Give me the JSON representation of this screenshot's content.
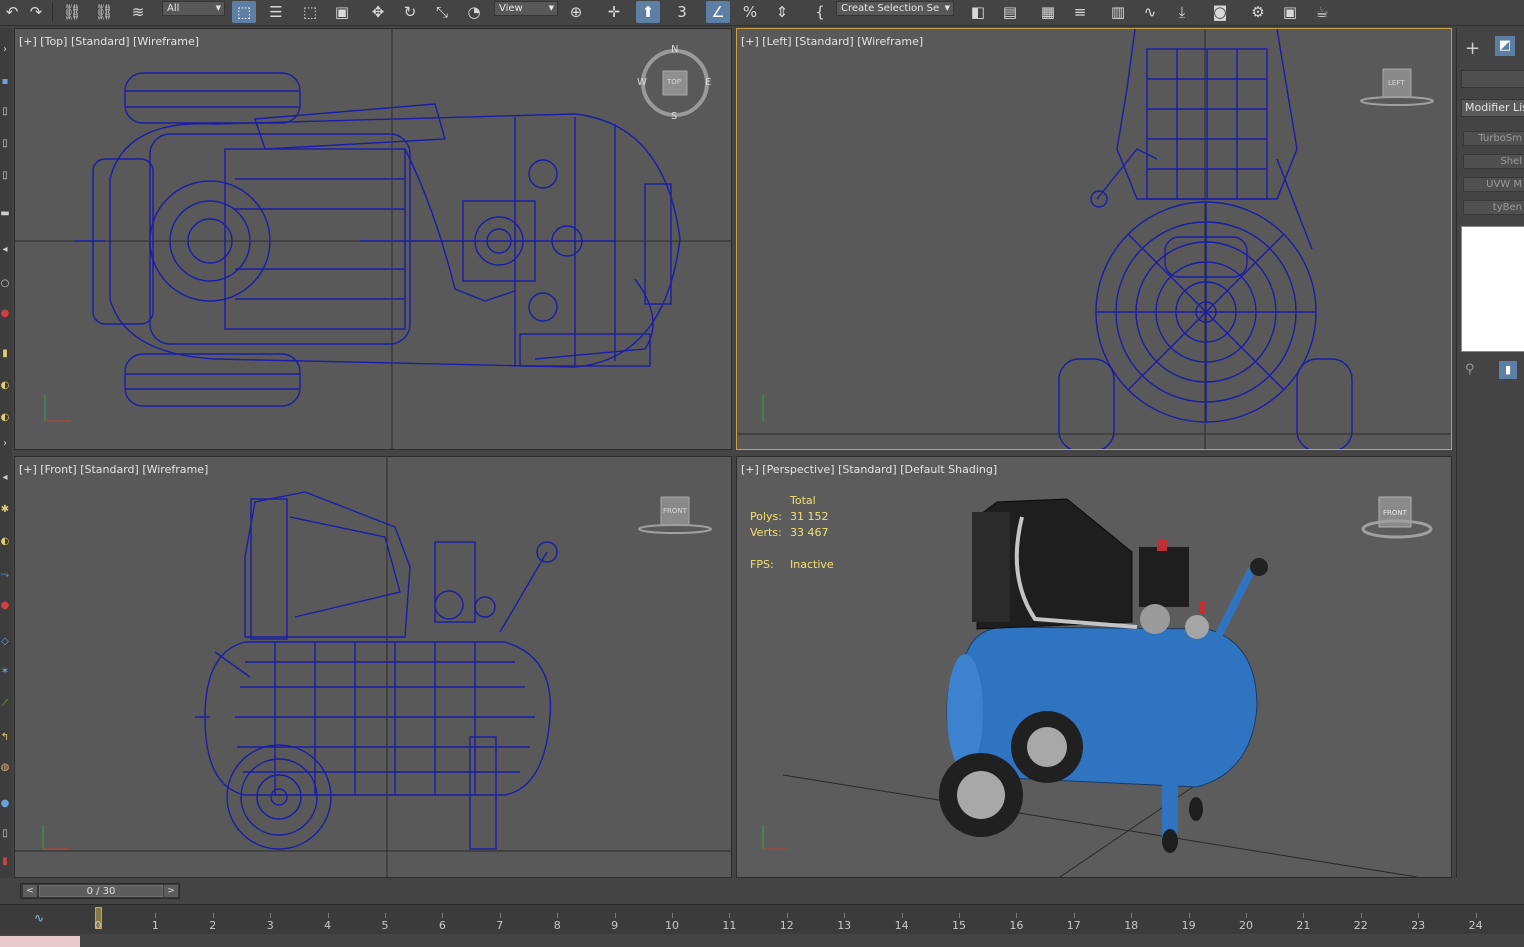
{
  "toolbar": {
    "selection_filter": "All",
    "coord_system": "View",
    "named_selection": "Create Selection Se"
  },
  "viewports": {
    "top": {
      "label": "[+] [Top] [Standard] [Wireframe]",
      "cube": "TOP",
      "compass": {
        "n": "N",
        "s": "S",
        "e": "E",
        "w": "W"
      }
    },
    "left": {
      "label": "[+] [Left] [Standard] [Wireframe]",
      "cube": "LEFT"
    },
    "front": {
      "label": "[+] [Front] [Standard] [Wireframe]",
      "cube": "FRONT"
    },
    "perspective": {
      "label": "[+] [Perspective] [Standard] [Default Shading]",
      "cube": "FRONT",
      "stats": {
        "header": "Total",
        "polys_label": "Polys:",
        "polys_value": "31 152",
        "verts_label": "Verts:",
        "verts_value": "33 467",
        "fps_label": "FPS:",
        "fps_value": "Inactive"
      }
    }
  },
  "command_panel": {
    "modifier_list": "Modifier List",
    "modifiers": [
      "TurboSm",
      "Shel",
      "UVW M",
      "tyBen"
    ]
  },
  "time_slider": {
    "position": "0 / 30",
    "prev": "<",
    "next": ">"
  },
  "track_ticks": [
    "0",
    "1",
    "2",
    "3",
    "4",
    "5",
    "6",
    "7",
    "8",
    "9",
    "10",
    "11",
    "12",
    "13",
    "14",
    "15",
    "16",
    "17",
    "18",
    "19",
    "20",
    "21",
    "22",
    "23",
    "24"
  ],
  "colors": {
    "wire": "#1c1ca8",
    "tank": "#2f74c0",
    "selected_border": "#c7a24a",
    "stats_text": "#f0e070"
  }
}
